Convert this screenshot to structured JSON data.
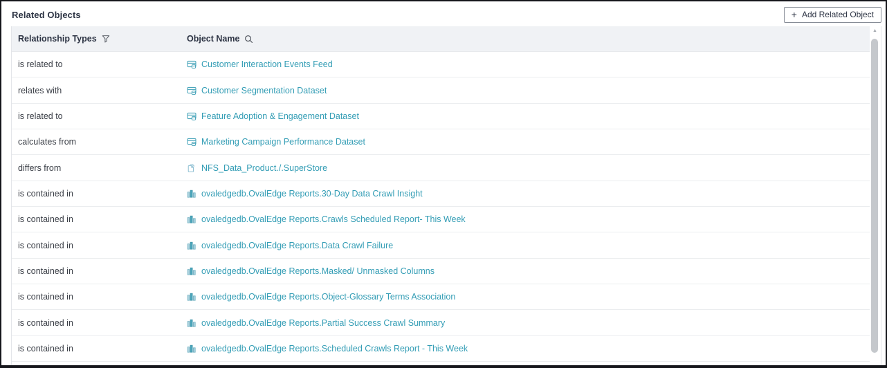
{
  "panel": {
    "title": "Related Objects"
  },
  "toolbar": {
    "add_button_icon": "+",
    "add_button_label": "Add Related Object"
  },
  "table": {
    "columns": [
      {
        "label": "Relationship Types",
        "icon": "filter-icon"
      },
      {
        "label": "Object Name",
        "icon": "search-icon"
      }
    ],
    "rows": [
      {
        "relationship": "is related to",
        "icon": "dataset-icon",
        "object": "Customer Interaction Events Feed"
      },
      {
        "relationship": "relates with",
        "icon": "dataset-icon",
        "object": "Customer Segmentation Dataset"
      },
      {
        "relationship": "is related to",
        "icon": "dataset-icon",
        "object": "Feature Adoption & Engagement Dataset"
      },
      {
        "relationship": "calculates from",
        "icon": "dataset-icon",
        "object": "Marketing Campaign Performance Dataset"
      },
      {
        "relationship": "differs from",
        "icon": "file-icon",
        "object": "NFS_Data_Product./.SuperStore"
      },
      {
        "relationship": "is contained in",
        "icon": "report-icon",
        "object": "ovaledgedb.OvalEdge Reports.30-Day Data Crawl Insight"
      },
      {
        "relationship": "is contained in",
        "icon": "report-icon",
        "object": "ovaledgedb.OvalEdge Reports.Crawls Scheduled Report- This Week"
      },
      {
        "relationship": "is contained in",
        "icon": "report-icon",
        "object": "ovaledgedb.OvalEdge Reports.Data Crawl Failure"
      },
      {
        "relationship": "is contained in",
        "icon": "report-icon",
        "object": "ovaledgedb.OvalEdge Reports.Masked/ Unmasked Columns"
      },
      {
        "relationship": "is contained in",
        "icon": "report-icon",
        "object": "ovaledgedb.OvalEdge Reports.Object-Glossary Terms Association"
      },
      {
        "relationship": "is contained in",
        "icon": "report-icon",
        "object": "ovaledgedb.OvalEdge Reports.Partial Success Crawl Summary"
      },
      {
        "relationship": "is contained in",
        "icon": "report-icon",
        "object": "ovaledgedb.OvalEdge Reports.Scheduled Crawls Report - This Week"
      }
    ]
  },
  "colors": {
    "link": "#339db5",
    "header_bg": "#f0f2f5",
    "title_text": "#2d3444",
    "row_text": "#3a3e46",
    "icon_teal": "#4ba6bb"
  }
}
